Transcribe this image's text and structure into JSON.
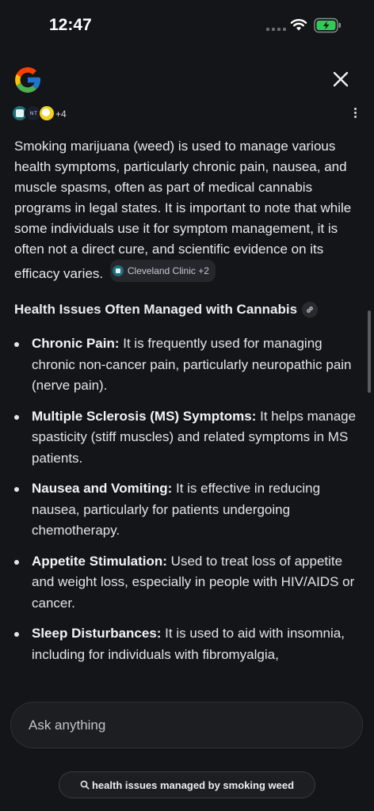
{
  "status_bar": {
    "time": "12:47"
  },
  "sources": {
    "more_count": "+4",
    "icon_2_text": "N T"
  },
  "answer": {
    "intro": "Smoking marijuana (weed) is used to manage various health symptoms, particularly chronic pain, nausea, and muscle spasms, often as part of medical cannabis programs in legal states. It is important to note that while some individuals use it for symptom management, it is often not a direct cure, and scientific evidence on its efficacy varies.",
    "citation_chip": "Cleveland Clinic +2",
    "section_heading": "Health Issues Often Managed with Cannabis",
    "items": [
      {
        "title": "Chronic Pain:",
        "text": " It is frequently used for managing chronic non-cancer pain, particularly neuropathic pain (nerve pain)."
      },
      {
        "title": "Multiple Sclerosis (MS) Symptoms:",
        "text": " It helps manage spasticity (stiff muscles) and related symptoms in MS patients."
      },
      {
        "title": "Nausea and Vomiting:",
        "text": " It is effective in reducing nausea, particularly for patients undergoing chemotherapy."
      },
      {
        "title": "Appetite Stimulation:",
        "text": " Used to treat loss of appetite and weight loss, especially in people with HIV/AIDS or cancer."
      },
      {
        "title": "Sleep Disturbances:",
        "text": " It is used to aid with insomnia, including for individuals with fibromyalgia,"
      }
    ]
  },
  "input": {
    "placeholder": "Ask anything"
  },
  "suggestion": {
    "label": "health issues managed by smoking weed"
  },
  "colors": {
    "background": "#141518",
    "accent_green": "#34c759"
  }
}
